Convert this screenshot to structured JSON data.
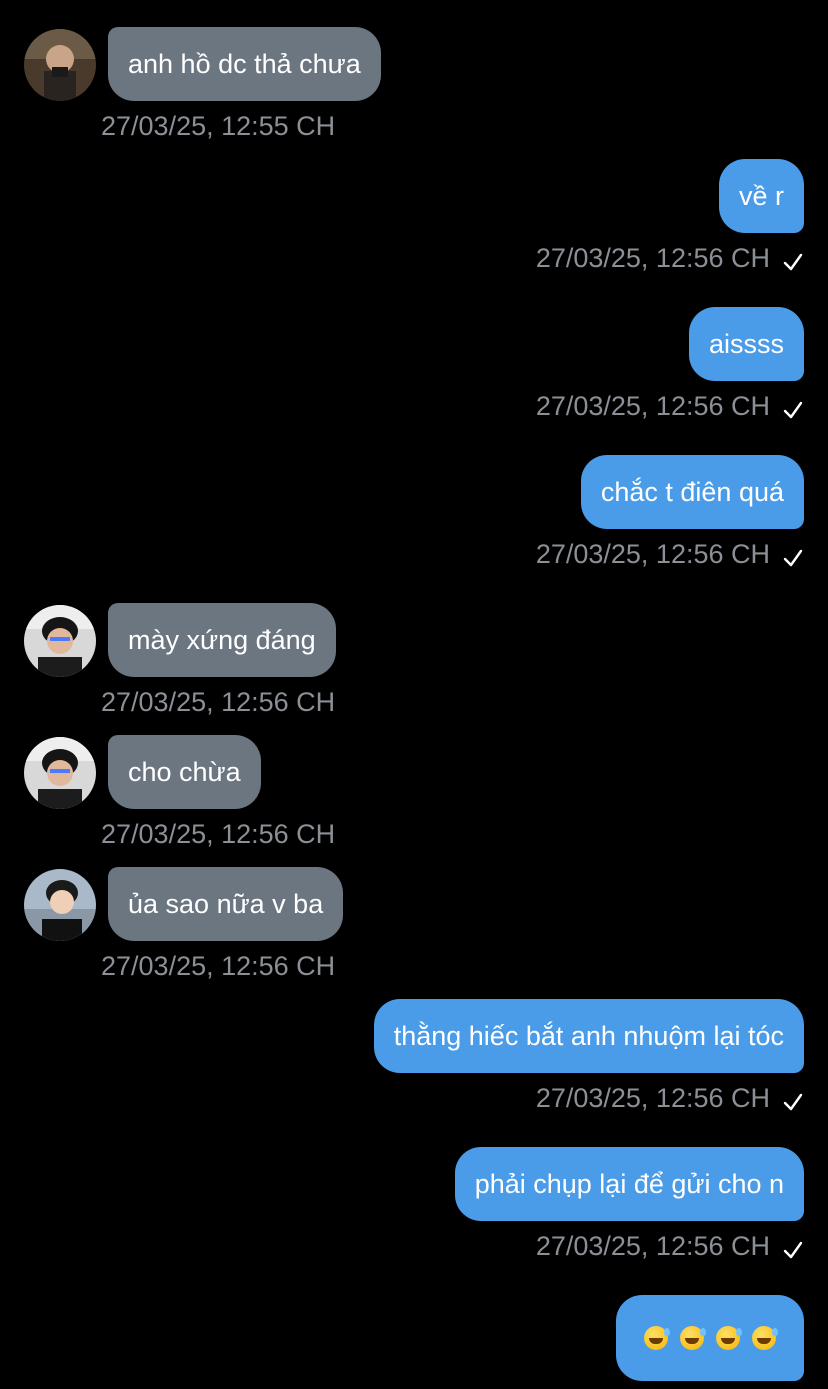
{
  "colors": {
    "background": "#000000",
    "incoming_bubble": "#6b7681",
    "outgoing_bubble": "#4a9be8",
    "timestamp": "#8b8f96"
  },
  "messages": [
    {
      "direction": "in",
      "text": "anh hồ dc thả chưa",
      "time": "27/03/25, 12:55 CH"
    },
    {
      "direction": "out",
      "text": "về r",
      "time": "27/03/25, 12:56 CH",
      "status_icon": "check-icon"
    },
    {
      "direction": "out",
      "text": "aissss",
      "time": "27/03/25, 12:56 CH",
      "status_icon": "check-icon"
    },
    {
      "direction": "out",
      "text": "chắc t điên quá",
      "time": "27/03/25, 12:56 CH",
      "status_icon": "check-icon"
    },
    {
      "direction": "in",
      "text": "mày xứng đáng",
      "time": "27/03/25, 12:56 CH"
    },
    {
      "direction": "in",
      "text": "cho chừa",
      "time": "27/03/25, 12:56 CH"
    },
    {
      "direction": "in",
      "text": "ủa sao nữa v ba",
      "time": "27/03/25, 12:56 CH"
    },
    {
      "direction": "out",
      "text": "thằng hiếc bắt anh nhuộm lại tóc",
      "time": "27/03/25, 12:56 CH",
      "status_icon": "check-icon"
    },
    {
      "direction": "out",
      "text": "phải chụp lại để gửi cho n",
      "time": "27/03/25, 12:56 CH",
      "status_icon": "check-icon"
    },
    {
      "direction": "out",
      "text": "😅😅😅😅",
      "emoji_icons": [
        "grinning-sweat-emoji",
        "grinning-sweat-emoji",
        "grinning-sweat-emoji",
        "grinning-sweat-emoji"
      ]
    }
  ]
}
